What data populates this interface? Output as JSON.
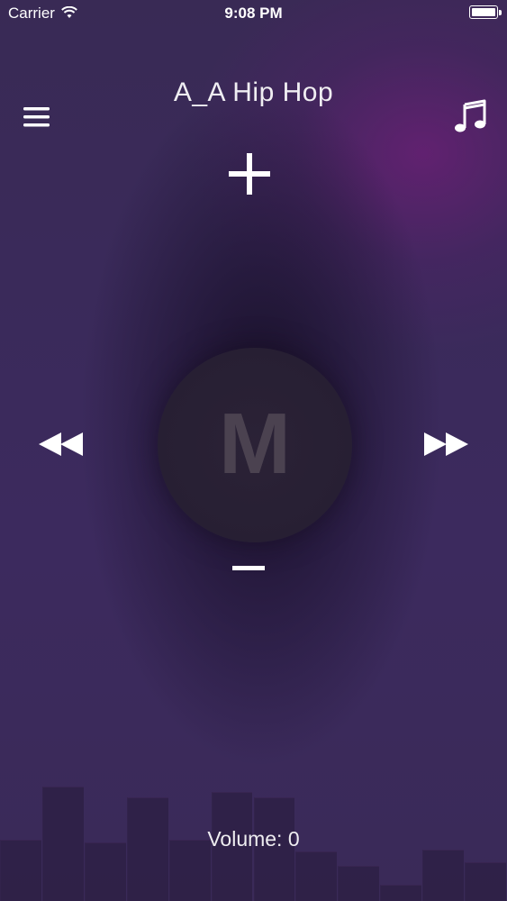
{
  "status_bar": {
    "carrier": "Carrier",
    "time": "9:08 PM",
    "wifi_icon": "wifi-icon",
    "battery_icon": "battery-icon"
  },
  "header": {
    "station_title": "A_A Hip Hop",
    "menu_icon": "hamburger-menu-icon",
    "music_icon": "music-note-icon"
  },
  "controls": {
    "add_icon": "plus-icon",
    "remove_icon": "minus-icon",
    "previous_icon": "rewind-icon",
    "next_icon": "fast-forward-icon"
  },
  "logo": {
    "letter": "M"
  },
  "equalizer": {
    "levels": [
      0.33,
      0.62,
      0.32,
      0.56,
      0.33,
      0.59,
      0.56,
      0.27,
      0.19,
      0.09,
      0.28,
      0.21
    ]
  },
  "volume": {
    "label": "Volume: 0"
  },
  "colors": {
    "background": "#3a2a58",
    "accent_glow": "#6e1e78",
    "foreground": "#ffffff",
    "logo_circle": "#271f33",
    "logo_letter": "#4b4250"
  }
}
